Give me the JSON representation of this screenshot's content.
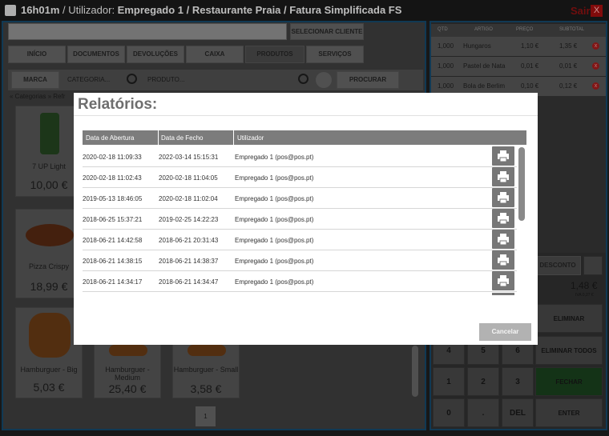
{
  "topbar": {
    "time": "16h01m",
    "separator": " / Utilizador: ",
    "context": "Empregado 1 / Restaurante Praia / Fatura Simplificada FS",
    "exit_label": "Sair",
    "close_label": "X"
  },
  "left": {
    "select_client_label": "SELECIONAR CLIENTE",
    "nav": [
      "INÍCIO",
      "DOCUMENTOS",
      "DEVOLUÇÕES",
      "CAIXA",
      "PRODUTOS",
      "SERVIÇOS"
    ],
    "filter": {
      "brand_label": "MARCA",
      "category_placeholder": "CATEGORIA...",
      "product_placeholder": "PRODUTO...",
      "search_label": "PROCURAR"
    },
    "breadcrumb": "« Categorias » Refr",
    "products": [
      {
        "name": "7 UP Light",
        "price": "10,00 €"
      },
      {
        "name": "Pizza Crispy",
        "price": "18,99 €"
      },
      {
        "name": "Hamburguer - Big",
        "price": "5,03 €"
      },
      {
        "name": "Hamburguer - Medium",
        "price": "25,40 €"
      },
      {
        "name": "Hamburguer - Small",
        "price": "3,58 €"
      }
    ],
    "page": "1"
  },
  "ticket": {
    "headers": [
      "QTD",
      "ARTIGO",
      "PREÇO",
      "SUBTOTAL"
    ],
    "rows": [
      {
        "qty": "1,000",
        "item": "Hungaros",
        "price": "1,10 €",
        "subtotal": "1,35 €"
      },
      {
        "qty": "1,000",
        "item": "Pastel de Nata",
        "price": "0,01 €",
        "subtotal": "0,01 €"
      },
      {
        "qty": "1,000",
        "item": "Bola de Berlim",
        "price": "0,10 €",
        "subtotal": "0,12 €"
      }
    ],
    "discount_label": "DESCONTO",
    "total": "1,48 €",
    "vat": "IVA 0,27 €",
    "keys": {
      "eliminar": "ELIMINAR",
      "eliminar_todos": "ELIMINAR TODOS",
      "fechar": "FECHAR",
      "enter": "ENTER",
      "k4": "4",
      "k5": "5",
      "k6": "6",
      "k1": "1",
      "k2": "2",
      "k3": "3",
      "k0": "0",
      "kdot": ".",
      "kdel": "DEL"
    }
  },
  "modal": {
    "title": "Relatórios:",
    "columns": [
      "Data de Abertura",
      "Data de Fecho",
      "Utilizador"
    ],
    "rows": [
      {
        "open": "2020-02-18 11:09:33",
        "close": "2022-03-14 15:15:31",
        "user": "Empregado 1 (pos@pos.pt)"
      },
      {
        "open": "2020-02-18 11:02:43",
        "close": "2020-02-18 11:04:05",
        "user": "Empregado 1 (pos@pos.pt)"
      },
      {
        "open": "2019-05-13 18:46:05",
        "close": "2020-02-18 11:02:04",
        "user": "Empregado 1 (pos@pos.pt)"
      },
      {
        "open": "2018-06-25 15:37:21",
        "close": "2019-02-25 14:22:23",
        "user": "Empregado 1 (pos@pos.pt)"
      },
      {
        "open": "2018-06-21 14:42:58",
        "close": "2018-06-21 20:31:43",
        "user": "Empregado 1 (pos@pos.pt)"
      },
      {
        "open": "2018-06-21 14:38:15",
        "close": "2018-06-21 14:38:37",
        "user": "Empregado 1 (pos@pos.pt)"
      },
      {
        "open": "2018-06-21 14:34:17",
        "close": "2018-06-21 14:34:47",
        "user": "Empregado 1 (pos@pos.pt)"
      }
    ],
    "cancel_label": "Cancelar"
  }
}
